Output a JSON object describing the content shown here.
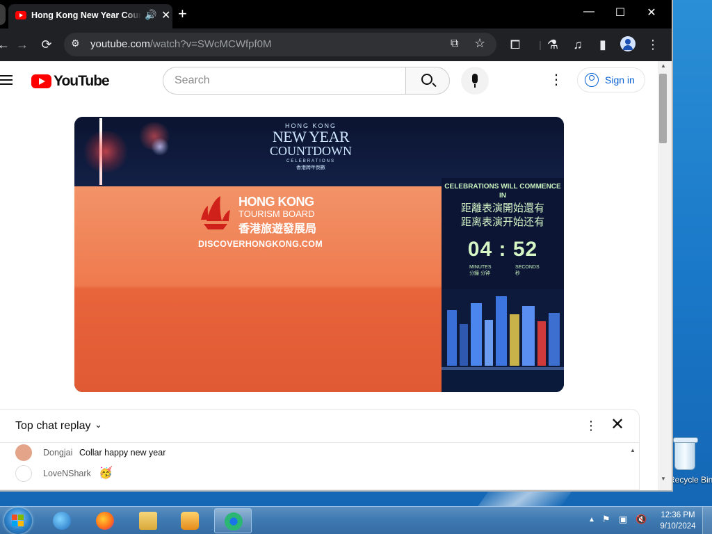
{
  "browser": {
    "tab_title": "Hong Kong New Year Countdown Celebrations",
    "new_tab_label": "+",
    "window_buttons": {
      "minimize": "—",
      "maximize": "☐",
      "close": "✕"
    },
    "url_host": "youtube.com",
    "url_rest": "/watch?v=SWcMCWfpf0M"
  },
  "youtube": {
    "logo_text": "YouTube",
    "search_placeholder": "Search",
    "signin_label": "Sign in"
  },
  "video": {
    "event_small": "HONG KONG",
    "event_line1": "NEW YEAR",
    "event_line2": "COUNTDOWN",
    "event_line3": "CELEBRATIONS",
    "event_chinese": "香港跨年倒數",
    "sponsor_line1": "HONG KONG",
    "sponsor_line2": "TOURISM BOARD",
    "sponsor_chinese": "香港旅遊發展局",
    "sponsor_url": "DISCOVERHONGKONG.COM",
    "commence_en": "CELEBRATIONS WILL COMMENCE IN",
    "commence_zh_trad": "距離表演開始還有",
    "commence_zh_simp": "距离表演开始还有",
    "countdown": "04 : 52",
    "minutes_label": "MINUTES",
    "minutes_zh": "分鐘 分钟",
    "seconds_label": "SECONDS",
    "seconds_zh": "秒"
  },
  "chat": {
    "header": "Top chat replay",
    "messages": [
      {
        "author": "Dongjai",
        "text": "Collar happy new year",
        "avatar_color": "#e3a489"
      },
      {
        "author": "LoveNShark",
        "text": "🥳",
        "avatar_color": "#222222"
      }
    ]
  },
  "desktop": {
    "recycle_bin_label": "Recycle Bin"
  },
  "taskbar": {
    "time": "12:36 PM",
    "date": "9/10/2024"
  },
  "colors": {
    "yt_red": "#ff0000",
    "chrome_dark": "#202124",
    "link_blue": "#065fd4",
    "video_orange": "#ef7a4e"
  }
}
